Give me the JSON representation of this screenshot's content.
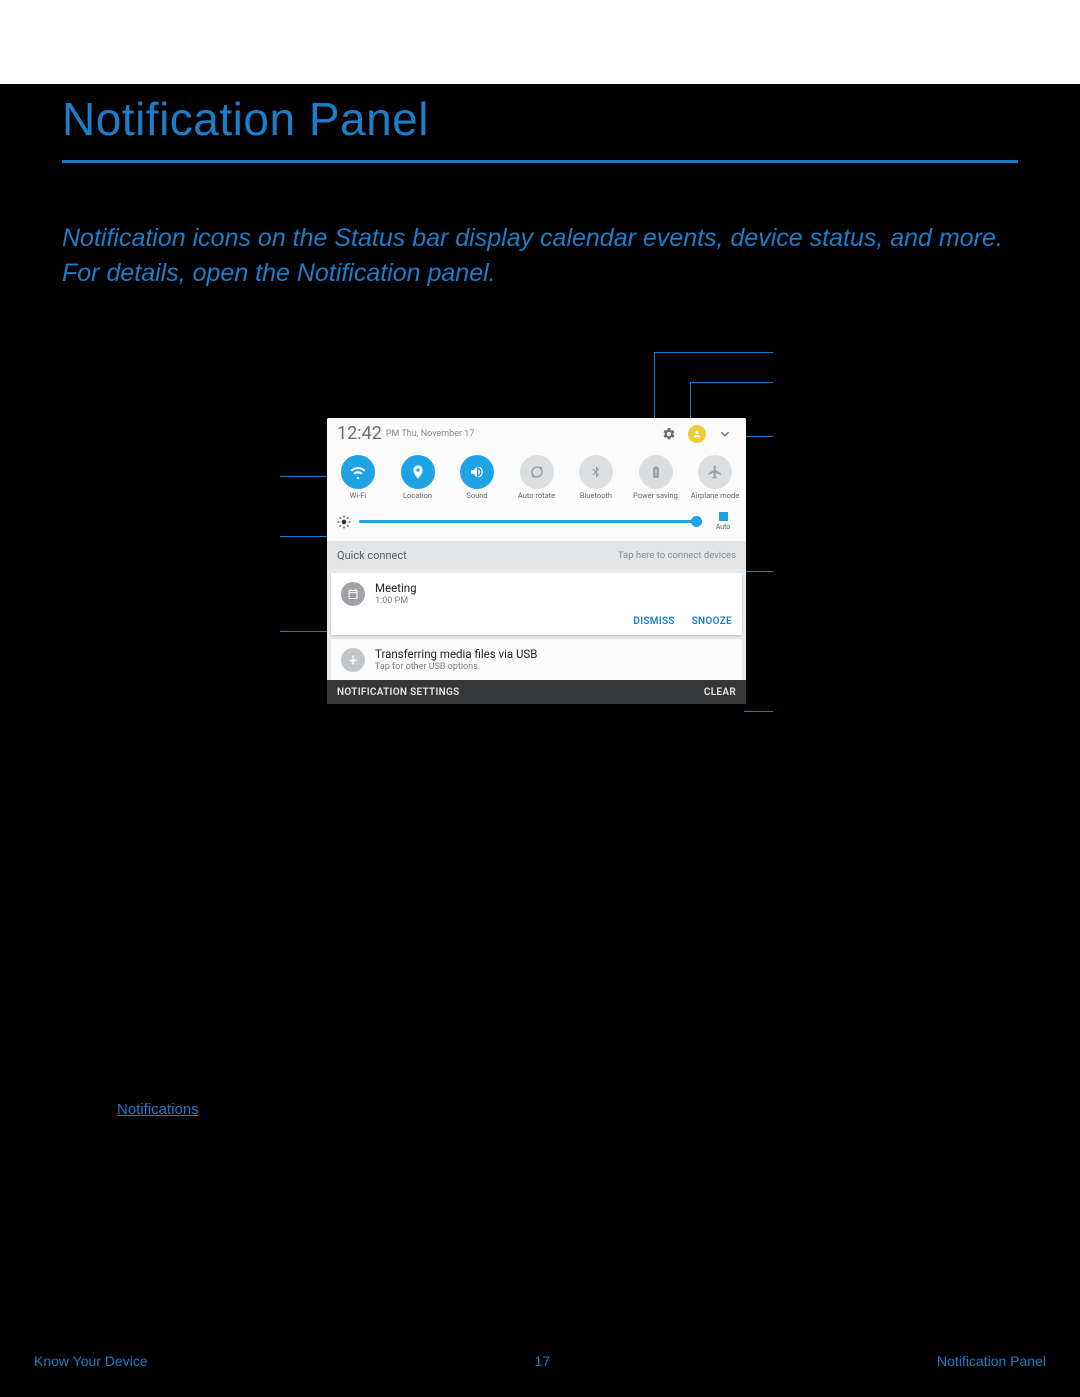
{
  "page": {
    "title": "Notification Panel",
    "intro": "Notification icons on the Status bar display calendar events, device status, and more. For details, open the Notification panel.",
    "link": "Notifications",
    "footer_left": "Know Your Device",
    "footer_center": "17",
    "footer_right": "Notification Panel"
  },
  "panel": {
    "time": "12:42",
    "date": "PM  Thu, November 17",
    "quick_settings": [
      {
        "label": "Wi-Fi",
        "on": true
      },
      {
        "label": "Location",
        "on": true
      },
      {
        "label": "Sound",
        "on": true
      },
      {
        "label": "Auto rotate",
        "on": false
      },
      {
        "label": "Bluetooth",
        "on": false
      },
      {
        "label": "Power saving",
        "on": false
      },
      {
        "label": "Airplane mode",
        "on": false
      }
    ],
    "brightness_auto": "Auto",
    "quick_connect": {
      "label": "Quick connect",
      "hint": "Tap here to connect devices"
    },
    "notif1": {
      "title": "Meeting",
      "time": "1:00 PM",
      "dismiss": "DISMISS",
      "snooze": "SNOOZE"
    },
    "notif2": {
      "title": "Transferring media files via USB",
      "sub": "Tap for other USB options."
    },
    "footer": {
      "settings": "NOTIFICATION SETTINGS",
      "clear": "CLEAR"
    }
  }
}
